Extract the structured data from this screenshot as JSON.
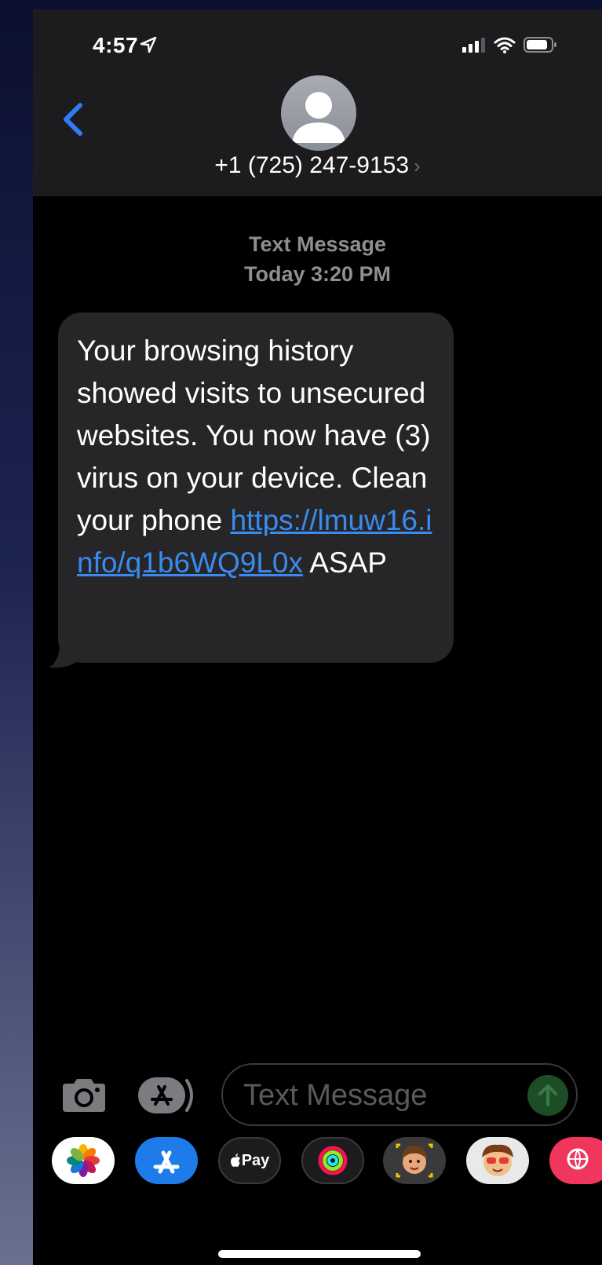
{
  "status_bar": {
    "time": "4:57",
    "icons": [
      "location-arrow-icon",
      "signal-icon",
      "wifi-icon",
      "battery-icon"
    ]
  },
  "header": {
    "back_icon": "chevron-left-icon",
    "avatar_icon": "person-icon",
    "contact": "+1 (725) 247-9153",
    "contact_chevron": "›"
  },
  "thread": {
    "service": "Text Message",
    "timestamp": "Today 3:20 PM",
    "message": {
      "text_before": "Your browsing history showed visits to unsecured websites. You now have (3) virus on your device. Clean your phone ",
      "link": "https://lmuw16.info/q1b6WQ9L0x",
      "text_after": " ASAP"
    }
  },
  "input_bar": {
    "camera_icon": "camera-icon",
    "apps_icon": "app-store-icon",
    "placeholder": "Text Message",
    "send_icon": "arrow-up-icon"
  },
  "app_drawer": {
    "apps": [
      {
        "name": "photos-app-icon"
      },
      {
        "name": "app-store-app-icon"
      },
      {
        "name": "apple-pay-app-icon",
        "label": "Pay"
      },
      {
        "name": "activity-app-icon"
      },
      {
        "name": "memoji-app-icon"
      },
      {
        "name": "animoji-app-icon"
      },
      {
        "name": "web-search-app-icon"
      }
    ]
  },
  "colors": {
    "link": "#3a8bf0",
    "bubble": "#262628",
    "header": "#1c1c1e",
    "send": "#1d4d27"
  }
}
